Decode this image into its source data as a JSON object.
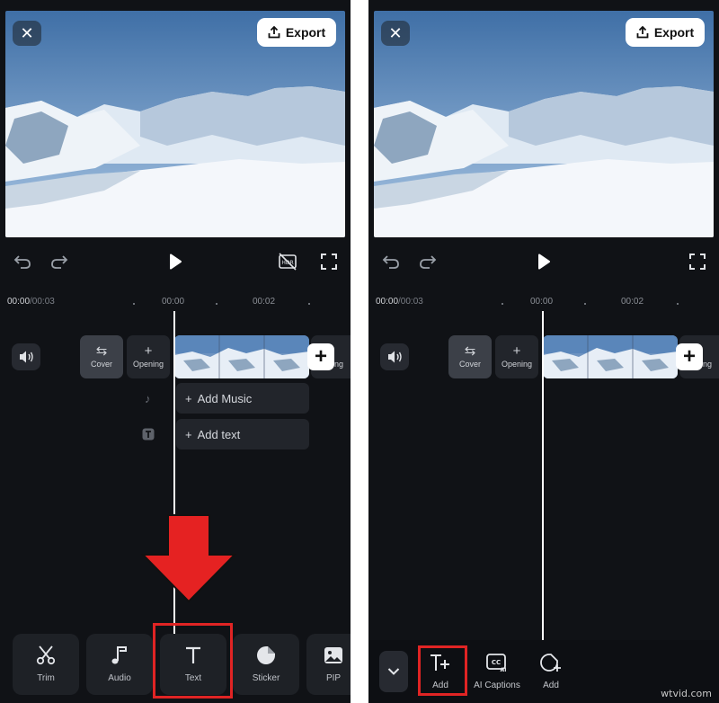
{
  "export_label": "Export",
  "left": {
    "time_current": "00:00",
    "time_total": "/00:03",
    "ticks": [
      "00:00",
      "00:02"
    ],
    "chips": {
      "cover": "Cover",
      "opening": "Opening",
      "ending": "Ending"
    },
    "tracks": {
      "music": "Add Music",
      "text": "Add text"
    },
    "toolbar": [
      "Trim",
      "Audio",
      "Text",
      "Sticker",
      "PIP"
    ]
  },
  "right": {
    "time_current": "00:00",
    "time_total": "/00:03",
    "ticks": [
      "00:00",
      "00:02"
    ],
    "chips": {
      "cover": "Cover",
      "opening": "Opening",
      "ending": "Ending"
    },
    "toolbar": [
      "Add",
      "AI Captions",
      "Add"
    ]
  },
  "colors": {
    "highlight": "#e02424",
    "arrow": "#e52222",
    "panel_bg": "#101216"
  },
  "watermark": "wtvid.com"
}
